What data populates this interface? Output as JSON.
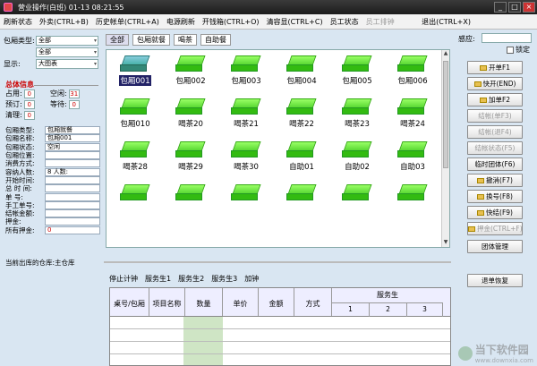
{
  "window": {
    "title": "营业操作(白班)   01-13 08:21:55",
    "min": "_",
    "max": "□",
    "close": "×"
  },
  "menu": [
    {
      "label": "刷新状态",
      "disabled": false
    },
    {
      "label": "外卖(CTRL+B)",
      "disabled": false
    },
    {
      "label": "历史帐单(CTRL+A)",
      "disabled": false
    },
    {
      "label": "电源刷新",
      "disabled": false
    },
    {
      "label": "开钱箱(CTRL+O)",
      "disabled": false
    },
    {
      "label": "清容显(CTRL+C)",
      "disabled": false
    },
    {
      "label": "员工状态",
      "disabled": false
    },
    {
      "label": "员工排钟",
      "disabled": true
    }
  ],
  "menu_exit": "退出(CTRL+X)",
  "left": {
    "room_type_label": "包厢类型:",
    "room_type_value": "全部",
    "filter2_value": "全部",
    "display_label": "显示:",
    "display_value": "大图表",
    "summary_title": "总体信息",
    "stats": {
      "occupied_label": "占用:",
      "occupied": "0",
      "free_label": "空闲:",
      "free": "31",
      "reserved_label": "预订:",
      "reserved": "0",
      "waiting_label": "等待:",
      "waiting": "0",
      "cleaning_label": "清理:",
      "cleaning": "0"
    },
    "info_rows": [
      {
        "k": "包厢类型:",
        "v": "包厢就餐"
      },
      {
        "k": "包厢名称:",
        "v": "包厢001"
      },
      {
        "k": "包厢状态:",
        "v": "空闲"
      },
      {
        "k": "包厢位置:",
        "v": ""
      },
      {
        "k": "消费方式:",
        "v": ""
      },
      {
        "k": "容纳人数:",
        "v": "8   人数:"
      },
      {
        "k": "开始时间:",
        "v": ""
      },
      {
        "k": "总 时 间:",
        "v": ""
      },
      {
        "k": "单    号:",
        "v": ""
      },
      {
        "k": "手工单号:",
        "v": ""
      },
      {
        "k": "结帐金额:",
        "v": ""
      },
      {
        "k": "押金:",
        "v": ""
      },
      {
        "k": "所有押金:",
        "v": "0"
      }
    ],
    "warehouse": "当前出库的仓库:主仓库"
  },
  "tabs": [
    "全部",
    "包厢就餐",
    "喝茶",
    "自助餐"
  ],
  "rooms": [
    "包厢001",
    "包厢002",
    "包厢003",
    "包厢004",
    "包厢005",
    "包厢006",
    "包厢010",
    "喝茶20",
    "喝茶21",
    "喝茶22",
    "喝茶23",
    "喝茶24",
    "喝茶28",
    "喝茶29",
    "喝茶30",
    "自助01",
    "自助02",
    "自助03",
    "",
    "",
    "",
    "",
    "",
    ""
  ],
  "subtabs": [
    "停止计钟",
    "服务生1",
    "服务生2",
    "服务生3",
    "加钟"
  ],
  "order_table": {
    "cols": [
      "桌号/包厢",
      "项目名称",
      "数量",
      "单价",
      "金额",
      "方式"
    ],
    "group": "服务生",
    "sub": [
      "1",
      "2",
      "3"
    ]
  },
  "right": {
    "sense_label": "感应:",
    "lock_label": "锁定",
    "buttons": [
      {
        "label": "开单F1",
        "icon": true,
        "disabled": false
      },
      {
        "label": "快开(END)",
        "icon": true,
        "disabled": false
      },
      {
        "label": "加单F2",
        "icon": true,
        "disabled": false
      },
      {
        "label": "结帐(单F3)",
        "icon": false,
        "disabled": true
      },
      {
        "label": "结帐(退F4)",
        "icon": false,
        "disabled": true
      },
      {
        "label": "结帐状态(F5)",
        "icon": false,
        "disabled": true
      },
      {
        "label": "临时团体(F6)",
        "icon": false,
        "disabled": false
      },
      {
        "label": "撤消(F7)",
        "icon": true,
        "disabled": false
      },
      {
        "label": "换号(F8)",
        "icon": true,
        "disabled": false
      },
      {
        "label": "快结(F9)",
        "icon": true,
        "disabled": false
      },
      {
        "label": "押金(CTRL+F)",
        "icon": true,
        "disabled": true
      },
      {
        "label": "团体管理",
        "icon": false,
        "disabled": false
      },
      {
        "label": "退单恢复",
        "icon": false,
        "disabled": false
      }
    ]
  },
  "watermark": {
    "text": "当下软件园",
    "url": "www.downxia.com"
  }
}
